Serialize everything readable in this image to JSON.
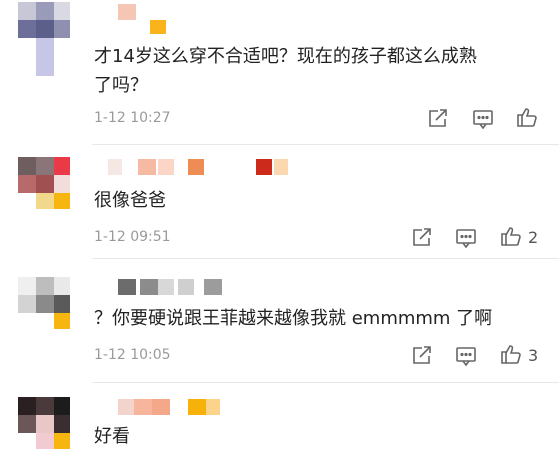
{
  "comments": [
    {
      "text": "才14岁这么穿不合适吧？现在的孩子都这么成熟",
      "text_line2": "了吗？",
      "time": "1-12 10:27",
      "likes": ""
    },
    {
      "text": "很像爸爸",
      "time": "1-12 09:51",
      "likes": "2"
    },
    {
      "text": "？你要硬说跟王菲越来越像我就 emmmmm 了啊",
      "time": "1-12 10:05",
      "likes": "3"
    },
    {
      "text": "好看",
      "time": "",
      "likes": ""
    }
  ],
  "icons": {
    "share": "share-icon",
    "reply": "comment-icon",
    "like": "thumbs-up-icon"
  },
  "colors": {
    "text": "#222222",
    "meta": "#9a9a9a",
    "icon": "#666666"
  }
}
